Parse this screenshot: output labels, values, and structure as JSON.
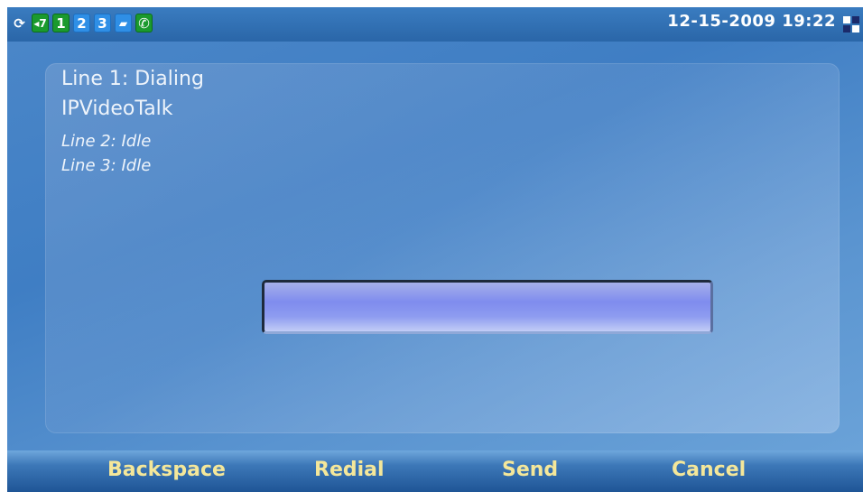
{
  "status_bar": {
    "icons": [
      {
        "name": "refresh-icon",
        "glyph": "⟳"
      },
      {
        "name": "volume-icon",
        "glyph": "◂7"
      },
      {
        "name": "line-1-icon",
        "label": "1"
      },
      {
        "name": "line-2-icon",
        "label": "2"
      },
      {
        "name": "line-3-icon",
        "label": "3"
      },
      {
        "name": "folder-icon",
        "glyph": "▰"
      },
      {
        "name": "phone-icon",
        "glyph": "✆"
      }
    ],
    "datetime": "12-15-2009 19:22"
  },
  "lines": {
    "line1_status": "Line 1: Dialing",
    "line1_account": "IPVideoTalk",
    "line2_status": "Line 2: Idle",
    "line3_status": "Line 3: Idle"
  },
  "dial_input": {
    "value": ""
  },
  "softkeys": {
    "backspace": "Backspace",
    "redial": "Redial",
    "send": "Send",
    "cancel": "Cancel"
  },
  "colors": {
    "background": "#2d6fb0",
    "softkey_text": "#f4e79a",
    "status_green": "#1b9a2e",
    "status_blue": "#2f8fe6"
  }
}
